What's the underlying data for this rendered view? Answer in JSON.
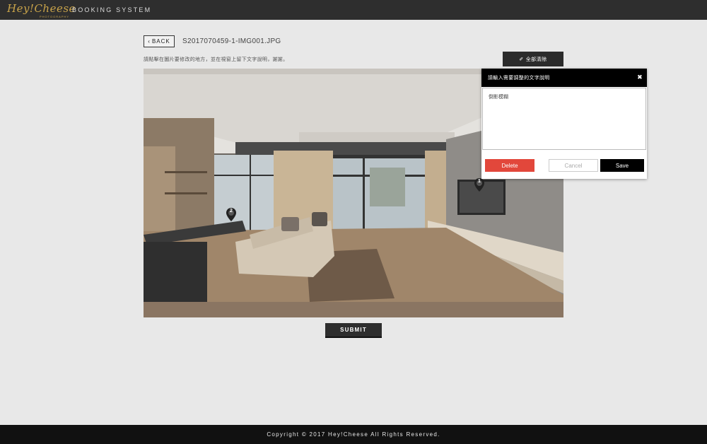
{
  "header": {
    "logo_text": "Hey!Cheese",
    "logo_sub": "PHOTOGRAPHY",
    "system_title": "BOOKING SYSTEM"
  },
  "editor": {
    "back_label": "BACK",
    "file_name": "S2017070459-1-IMG001.JPG",
    "instruction": "請點擊在圖片要修改的地方，並在視窗上留下文字說明，謝謝。",
    "clear_all_label": "全部清除",
    "submit_label": "SUBMIT",
    "pins": [
      {
        "label": "1"
      },
      {
        "label": "2"
      }
    ]
  },
  "popup": {
    "title": "請輸入需要調整的文字說明",
    "close_symbol": "✖",
    "comment_text": "倒影模糊",
    "delete_label": "Delete",
    "cancel_label": "Cancel",
    "save_label": "Save"
  },
  "footer": {
    "copyright": "Copyright © 2017 Hey!Cheese All Rights Reserved."
  },
  "colors": {
    "header_bg": "#2e2e2e",
    "brand_gold": "#c9a44a",
    "delete_red": "#e2473b",
    "footer_bg": "#111111"
  }
}
